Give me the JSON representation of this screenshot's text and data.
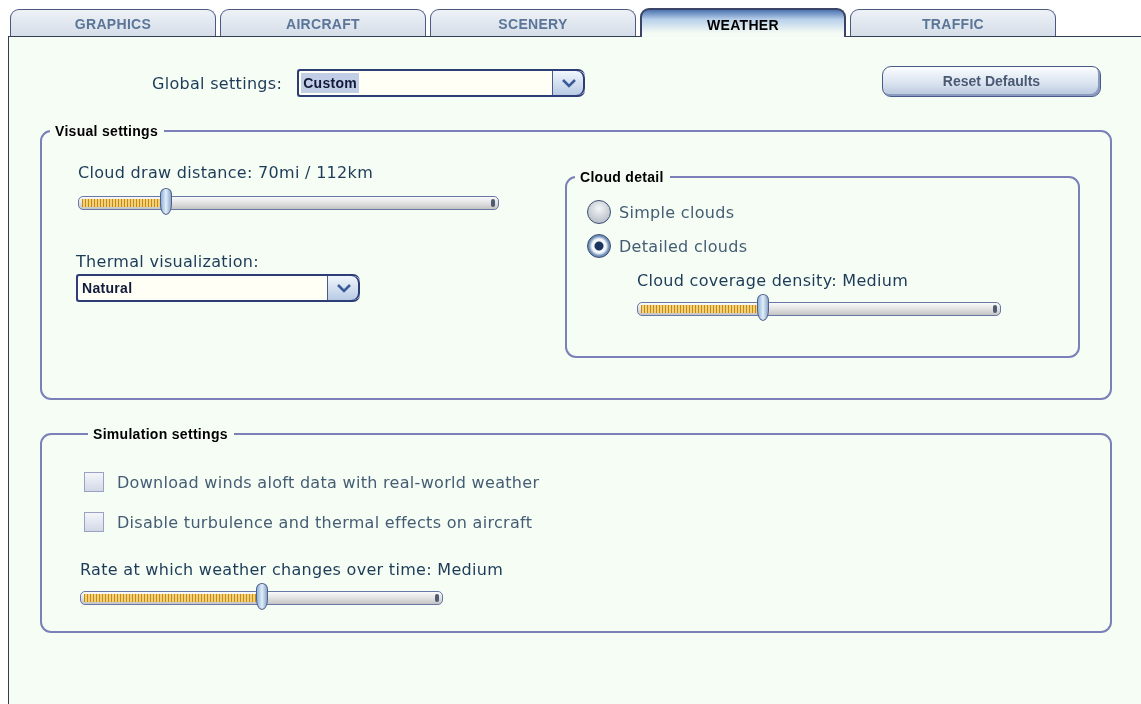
{
  "tabs": [
    {
      "label": "GRAPHICS",
      "selected": false
    },
    {
      "label": "AIRCRAFT",
      "selected": false
    },
    {
      "label": "SCENERY",
      "selected": false
    },
    {
      "label": "WEATHER",
      "selected": true
    },
    {
      "label": "TRAFFIC",
      "selected": false
    }
  ],
  "global_settings": {
    "label": "Global settings:",
    "value": "Custom"
  },
  "reset_button": "Reset Defaults",
  "visual_settings": {
    "title": "Visual settings",
    "cloud_draw_distance": {
      "label": "Cloud draw distance: 70mi / 112km",
      "level": 0.2
    },
    "thermal_visualization": {
      "label": "Thermal visualization:",
      "value": "Natural"
    },
    "cloud_detail": {
      "title": "Cloud detail",
      "options": [
        {
          "label": "Simple clouds",
          "selected": false
        },
        {
          "label": "Detailed clouds",
          "selected": true
        }
      ],
      "cloud_coverage_density": {
        "label": "Cloud coverage density: Medium",
        "level": 0.34
      }
    }
  },
  "simulation_settings": {
    "title": "Simulation settings",
    "checkboxes": [
      {
        "label": "Download winds aloft data with real-world weather",
        "checked": false
      },
      {
        "label": "Disable turbulence and thermal effects on aircraft",
        "checked": false
      }
    ],
    "weather_change_rate": {
      "label": "Rate at which weather changes over time: Medium",
      "level": 0.5
    }
  }
}
